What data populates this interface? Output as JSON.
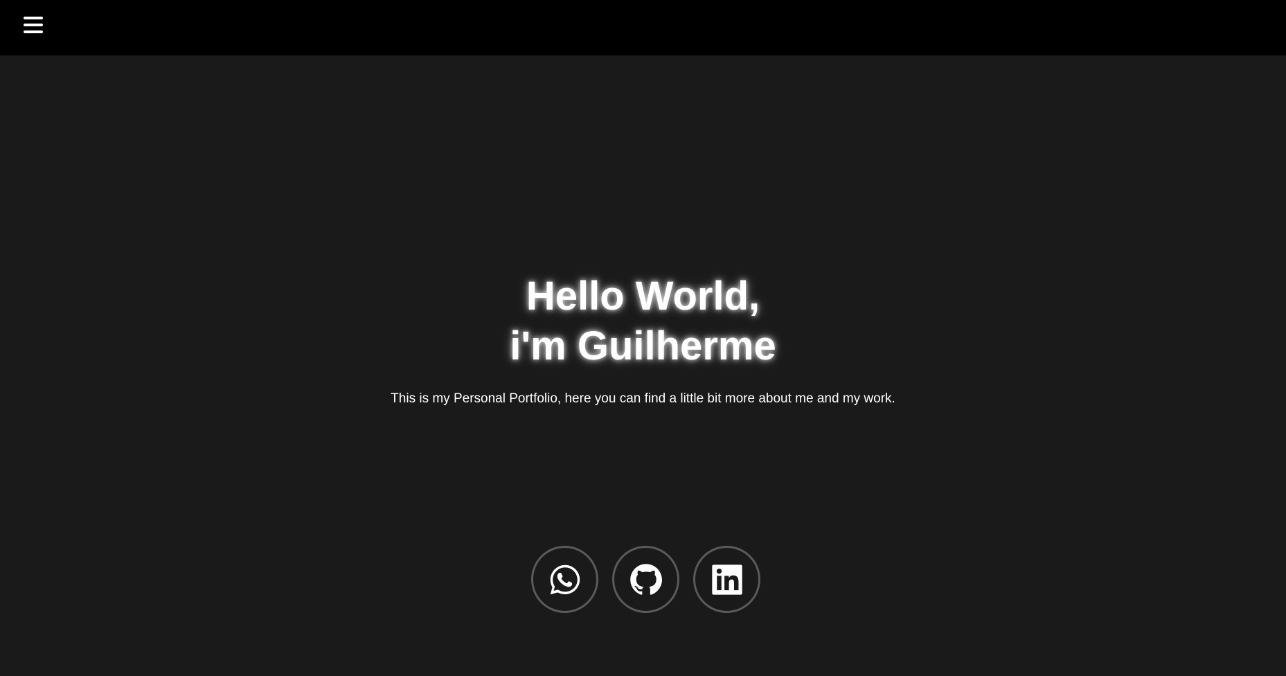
{
  "header": {
    "menu_icon": "hamburger-menu-icon",
    "background": "#000000"
  },
  "hero": {
    "title_line1": "Hello World,",
    "title_line2": "i'm Guilherme",
    "subtitle": "This is my Personal Portfolio, here you can find a little bit more about me and my work."
  },
  "socials": [
    {
      "icon": "whatsapp-icon"
    },
    {
      "icon": "github-icon"
    },
    {
      "icon": "linkedin-icon"
    }
  ],
  "colors": {
    "page_background": "#1a1a1a",
    "text": "#ffffff",
    "social_border": "#5a5a5a"
  }
}
